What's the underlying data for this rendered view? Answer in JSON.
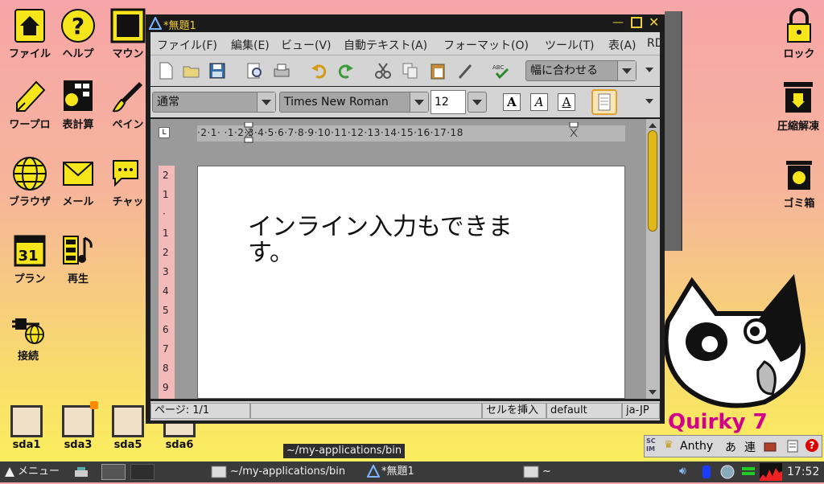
{
  "desktop": {
    "icons_left": [
      {
        "label": "ファイル",
        "icon": "home-folder-icon"
      },
      {
        "label": "ヘルプ",
        "icon": "help-icon"
      },
      {
        "label": "マウン",
        "icon": "mount-icon"
      },
      {
        "label": "ワープロ",
        "icon": "word-processor-icon"
      },
      {
        "label": "表計算",
        "icon": "spreadsheet-icon"
      },
      {
        "label": "ペイン",
        "icon": "paint-icon"
      },
      {
        "label": "ブラウザ",
        "icon": "browser-icon"
      },
      {
        "label": "メール",
        "icon": "mail-icon"
      },
      {
        "label": "チャッ",
        "icon": "chat-icon"
      },
      {
        "label": "プラン",
        "icon": "calendar-icon"
      },
      {
        "label": "再生",
        "icon": "media-player-icon"
      },
      {
        "label": "接続",
        "icon": "network-connect-icon"
      }
    ],
    "drives": [
      {
        "label": "sda1"
      },
      {
        "label": "sda3"
      },
      {
        "label": "sda5"
      },
      {
        "label": "sda6"
      }
    ],
    "icons_right": [
      {
        "label": "ロック",
        "icon": "lock-icon"
      },
      {
        "label": "圧縮解凍",
        "icon": "archive-icon"
      },
      {
        "label": "ゴミ箱",
        "icon": "trash-icon"
      }
    ],
    "wallpaper_text": "Quirky 7",
    "tooltip": "~/my-applications/bin"
  },
  "window": {
    "title": "*無題1",
    "menu": [
      "ファイル(F)",
      "編集(E)",
      "ビュー(V)",
      "自動テキスト(A)",
      "フォーマット(O)",
      "ツール(T)",
      "表(A)",
      "RD"
    ],
    "zoom_value": "幅に合わせる",
    "style_value": "通常",
    "font_value": "Times New Roman",
    "size_value": "12",
    "hruler_text": "·2·1· ·1·2·3·4·5·6·7·8·9·10·11·12·13·14·15·16·17·18",
    "vruler_text": "2 1 · 1 2 3 4 5 6 7 8 9",
    "document_text": "インライン入力もできます。",
    "status": {
      "page": "ページ: 1/1",
      "insert_mode": "セルを挿入",
      "style": "default",
      "lang": "ja-JP"
    }
  },
  "ime": {
    "engine": "Anthy",
    "mode": "あ",
    "conv": "連"
  },
  "taskbar": {
    "menu_label": "メニュー",
    "tasks": [
      {
        "label": "~/my-applications/bin"
      },
      {
        "label": "*無題1"
      },
      {
        "label": "~"
      }
    ],
    "clock": "17:52"
  },
  "colors": {
    "accent_yellow": "#f5e51a",
    "title_text": "#f2d03b",
    "taskbar_bg": "#3a3a3a"
  }
}
